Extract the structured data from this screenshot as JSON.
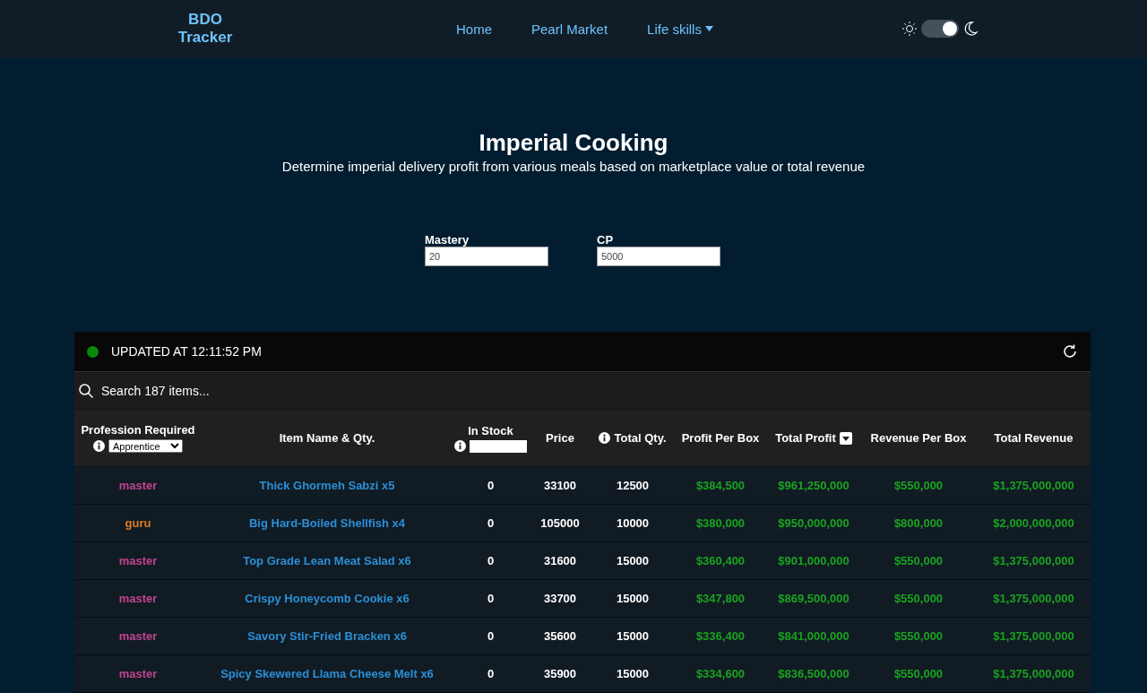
{
  "nav": {
    "logo": "BDO Tracker",
    "links": [
      {
        "label": "Home",
        "dropdown": false
      },
      {
        "label": "Pearl Market",
        "dropdown": false
      },
      {
        "label": "Life skills",
        "dropdown": true
      }
    ],
    "dark_mode": true
  },
  "header": {
    "title": "Imperial Cooking",
    "subtitle": "Determine imperial delivery profit from various meals based on marketplace value or total revenue"
  },
  "inputs": [
    {
      "label": "Mastery",
      "value": "20"
    },
    {
      "label": "CP",
      "value": "5000"
    }
  ],
  "table": {
    "status": "UPDATED AT 12:11:52 PM",
    "search": {
      "placeholder": "Search 187 items..."
    },
    "columns": [
      {
        "label": "Profession Required",
        "info": true,
        "kind": "select",
        "filter_value": "Apprentice",
        "sorted": false
      },
      {
        "label": "Item Name & Qty.",
        "info": false,
        "sorted": false
      },
      {
        "label": "In Stock",
        "info": true,
        "kind": "input",
        "sorted": false
      },
      {
        "label": "Price",
        "info": false,
        "sorted": false
      },
      {
        "label": "Total Qty.",
        "info": true,
        "sorted": false
      },
      {
        "label": "Profit Per Box",
        "info": false,
        "sorted": false
      },
      {
        "label": "Total Profit",
        "info": false,
        "sorted": true
      },
      {
        "label": "Revenue Per Box",
        "info": false,
        "sorted": false
      },
      {
        "label": "Total Revenue",
        "info": false,
        "sorted": false
      }
    ],
    "rows": [
      {
        "color": "#c0448f",
        "cells": [
          "master",
          "Thick Ghormeh Sabzi x5",
          "0",
          "33100",
          "12500",
          "$384,500",
          "$961,250,000",
          "$550,000",
          "$1,375,000,000"
        ]
      },
      {
        "color": "#e07b24",
        "cells": [
          "guru",
          "Big Hard-Boiled Shellfish x4",
          "0",
          "105000",
          "10000",
          "$380,000",
          "$950,000,000",
          "$800,000",
          "$2,000,000,000"
        ]
      },
      {
        "color": "#c0448f",
        "cells": [
          "master",
          "Top Grade Lean Meat Salad x6",
          "0",
          "31600",
          "15000",
          "$360,400",
          "$901,000,000",
          "$550,000",
          "$1,375,000,000"
        ]
      },
      {
        "color": "#c0448f",
        "cells": [
          "master",
          "Crispy Honeycomb Cookie x6",
          "0",
          "33700",
          "15000",
          "$347,800",
          "$869,500,000",
          "$550,000",
          "$1,375,000,000"
        ]
      },
      {
        "color": "#c0448f",
        "cells": [
          "master",
          "Savory Stir-Fried Bracken x6",
          "0",
          "35600",
          "15000",
          "$336,400",
          "$841,000,000",
          "$550,000",
          "$1,375,000,000"
        ]
      },
      {
        "color": "#c0448f",
        "cells": [
          "master",
          "Spicy Skewered Llama Cheese Melt x6",
          "0",
          "35900",
          "15000",
          "$334,600",
          "$836,500,000",
          "$550,000",
          "$1,375,000,000"
        ]
      }
    ]
  }
}
